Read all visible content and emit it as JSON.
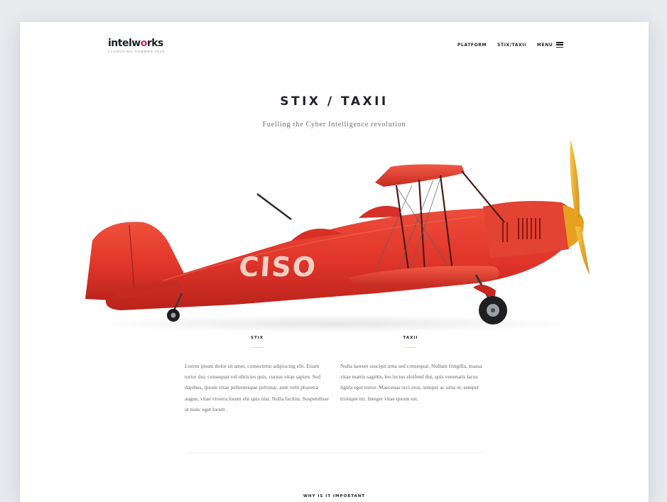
{
  "header": {
    "logo_text": "intelworks",
    "logo_tagline": "LAUNCHING SUMMER 2015",
    "nav": {
      "platform": "PLATFORM",
      "stix_taxii": "STIX/TAXII",
      "menu": "MENU"
    }
  },
  "hero": {
    "title": "STIX / TAXII",
    "subtitle": "Fuelling the Cyber Intelligence revolution",
    "illustration": {
      "subject": "red-biplane",
      "fuselage_text": "CISO",
      "colors": {
        "body": "#e7372a",
        "body_dark": "#b8231b",
        "propeller": "#f2b233",
        "logo_text": "#f6cfc3"
      }
    }
  },
  "columns": [
    {
      "heading": "STIX",
      "body": "Lorem ipsum dolor sit amet, consectetur adipiscing elit. Etiam tortor dui, consequat vel ultricies quis, cursus vitae sapien. Sed dapibus, ipsum vitae pellentesque pulvinar, ante velit pharetra augue, vitae viverra lorem elit quis nisi. Nulla facilisi. Suspendisse ut nunc eget lorem ."
    },
    {
      "heading": "TAXII",
      "body": "Nulla laoreet suscipit urna sed consequat. Nullam fringilla, massa vitae mattis sagittis, leo lectus eleifend dui, quis venenatis lacus ligula eget tortor. Maecenas orci eros, semper ac urna et, semper tristique mi. Integer vitae ipsum est."
    }
  ],
  "next_section": {
    "heading": "WHY IS IT IMPORTANT"
  },
  "colors": {
    "accent": "#d6245b",
    "text": "#1c1f26",
    "muted": "#63666e",
    "background": "#e8eaee"
  }
}
